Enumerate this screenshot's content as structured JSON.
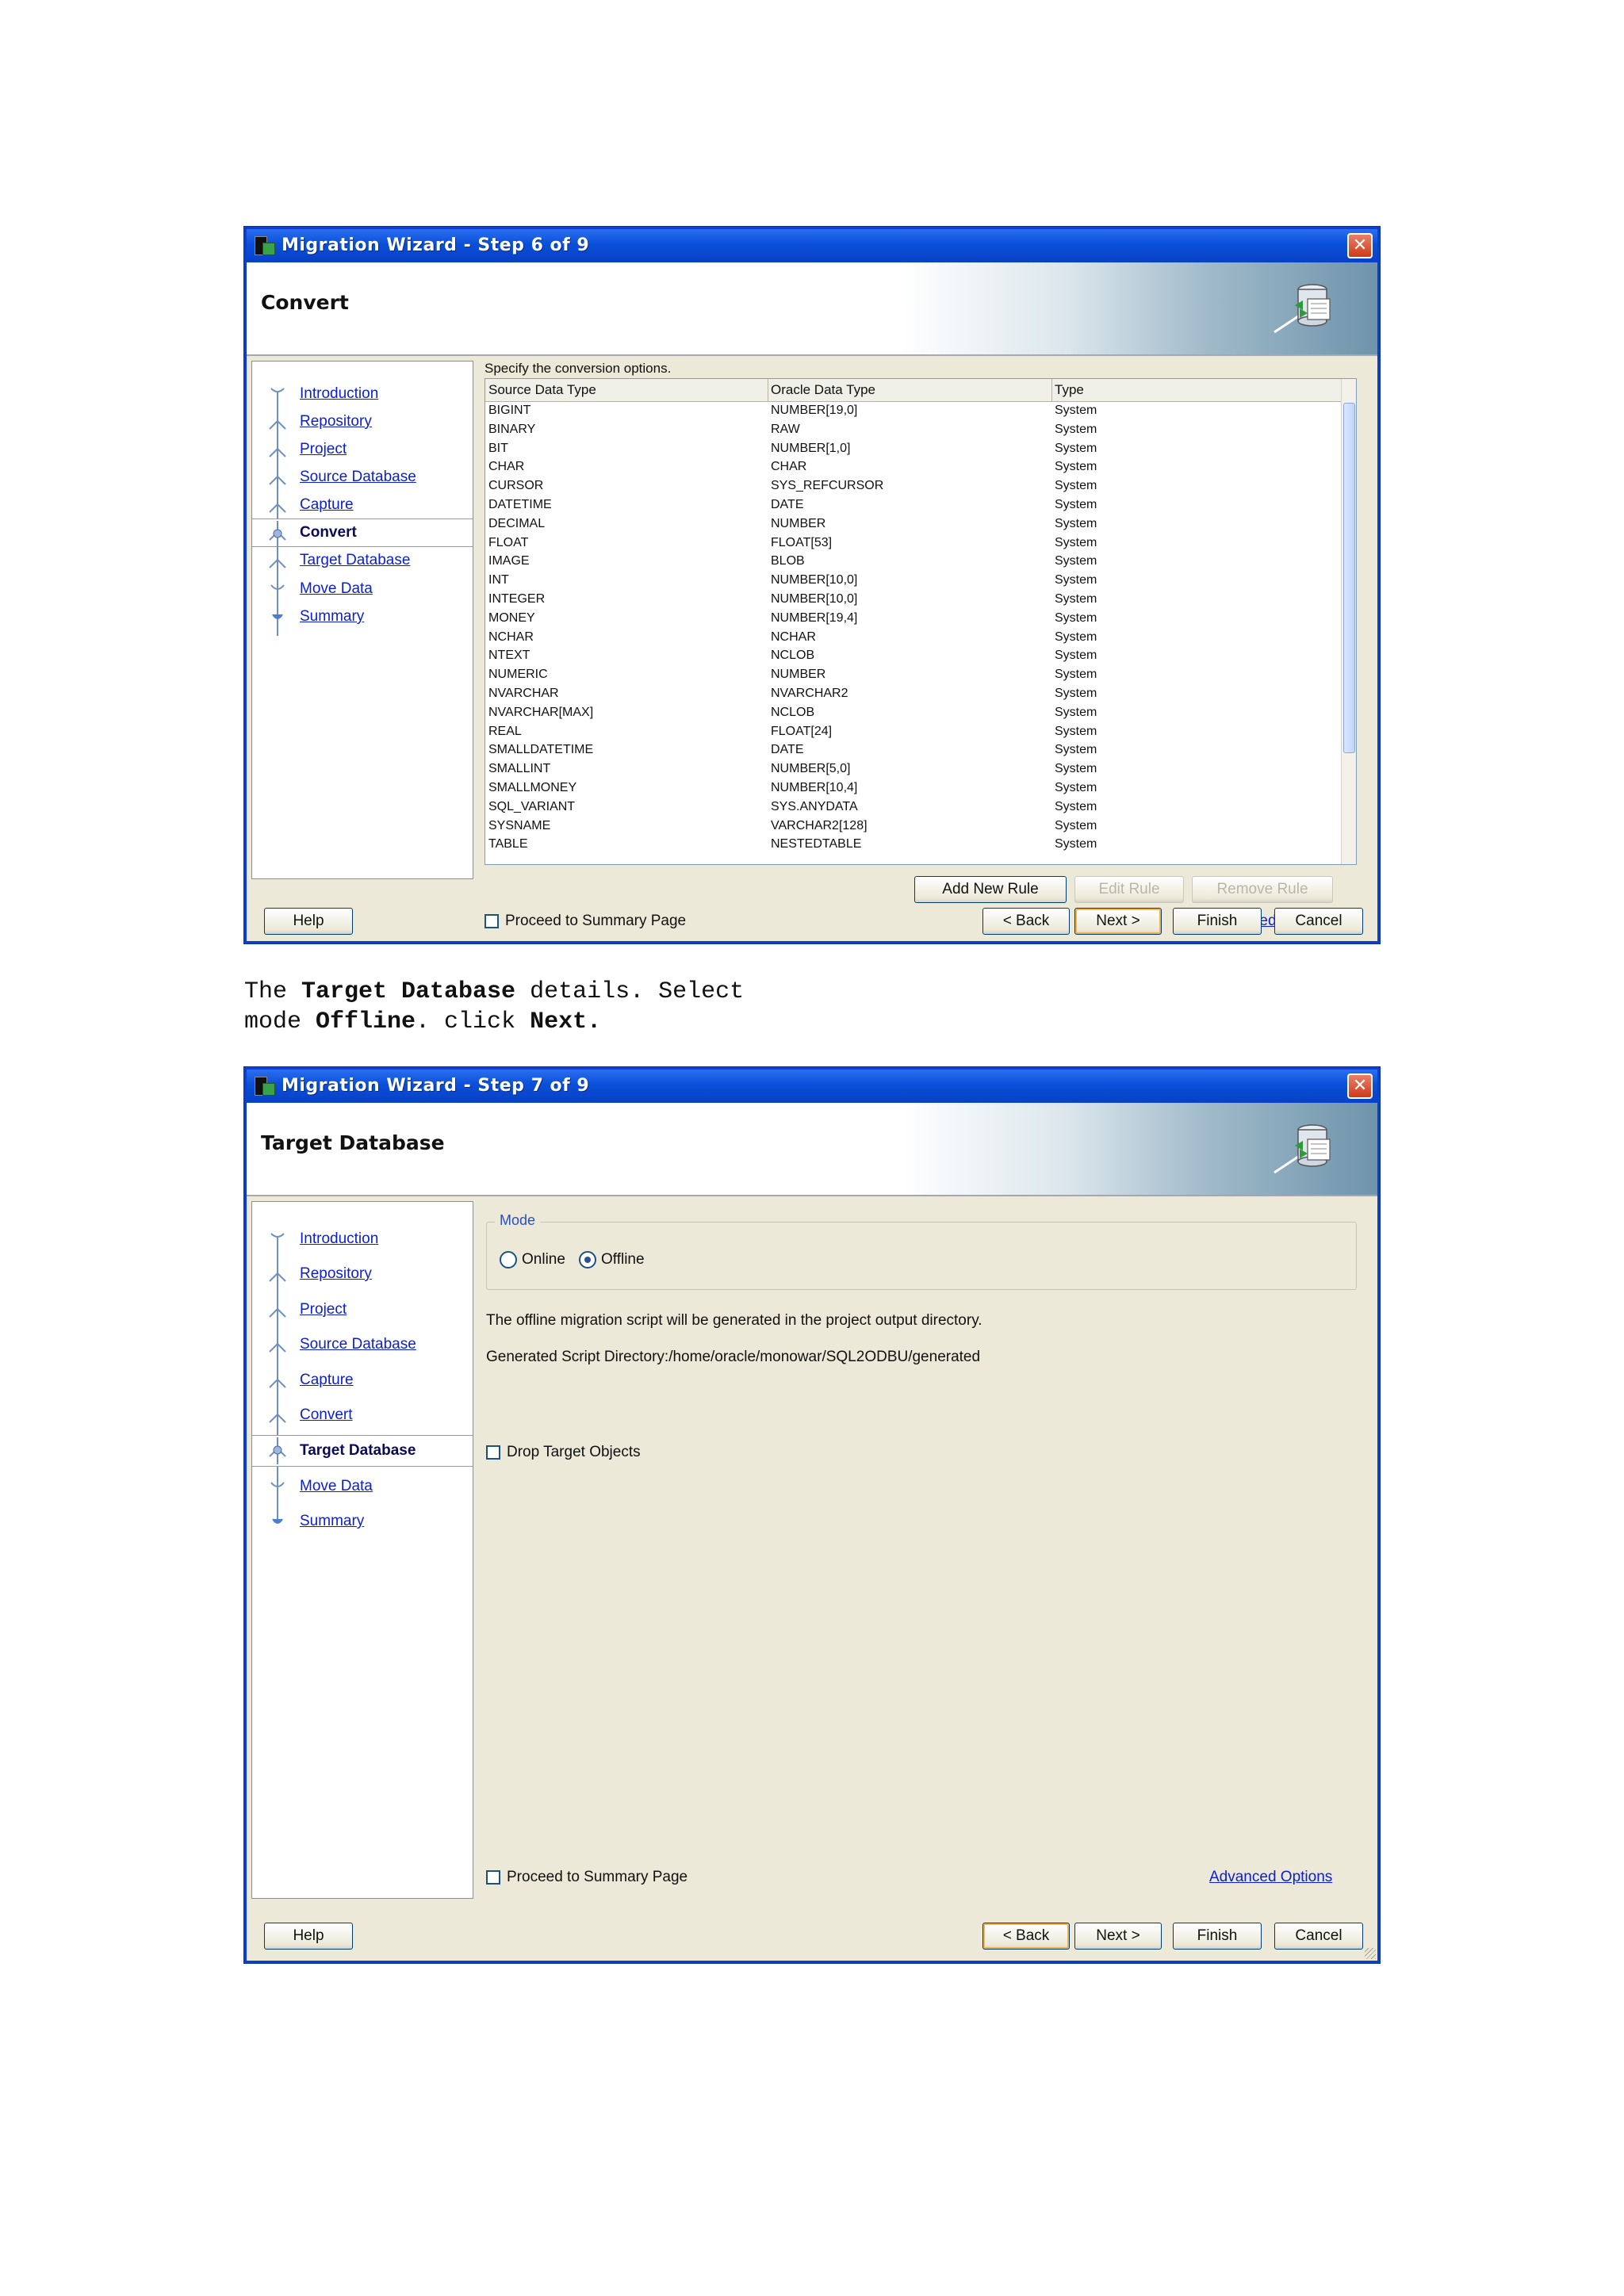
{
  "wizard_step6": {
    "title": "Migration Wizard - Step 6 of 9",
    "page_title": "Convert",
    "nav": [
      "Introduction",
      "Repository",
      "Project",
      "Source Database",
      "Capture",
      "Convert",
      "Target Database",
      "Move Data",
      "Summary"
    ],
    "active_nav": "Convert",
    "instruction": "Specify the conversion options.",
    "table": {
      "columns": [
        "Source Data Type",
        "Oracle Data Type",
        "Type"
      ],
      "rows": [
        [
          "BIGINT",
          "NUMBER[19,0]",
          "System"
        ],
        [
          "BINARY",
          "RAW",
          "System"
        ],
        [
          "BIT",
          "NUMBER[1,0]",
          "System"
        ],
        [
          "CHAR",
          "CHAR",
          "System"
        ],
        [
          "CURSOR",
          "SYS_REFCURSOR",
          "System"
        ],
        [
          "DATETIME",
          "DATE",
          "System"
        ],
        [
          "DECIMAL",
          "NUMBER",
          "System"
        ],
        [
          "FLOAT",
          "FLOAT[53]",
          "System"
        ],
        [
          "IMAGE",
          "BLOB",
          "System"
        ],
        [
          "INT",
          "NUMBER[10,0]",
          "System"
        ],
        [
          "INTEGER",
          "NUMBER[10,0]",
          "System"
        ],
        [
          "MONEY",
          "NUMBER[19,4]",
          "System"
        ],
        [
          "NCHAR",
          "NCHAR",
          "System"
        ],
        [
          "NTEXT",
          "NCLOB",
          "System"
        ],
        [
          "NUMERIC",
          "NUMBER",
          "System"
        ],
        [
          "NVARCHAR",
          "NVARCHAR2",
          "System"
        ],
        [
          "NVARCHAR[MAX]",
          "NCLOB",
          "System"
        ],
        [
          "REAL",
          "FLOAT[24]",
          "System"
        ],
        [
          "SMALLDATETIME",
          "DATE",
          "System"
        ],
        [
          "SMALLINT",
          "NUMBER[5,0]",
          "System"
        ],
        [
          "SMALLMONEY",
          "NUMBER[10,4]",
          "System"
        ],
        [
          "SQL_VARIANT",
          "SYS.ANYDATA",
          "System"
        ],
        [
          "SYSNAME",
          "VARCHAR2[128]",
          "System"
        ],
        [
          "TABLE",
          "NESTEDTABLE",
          "System"
        ]
      ]
    },
    "buttons": {
      "add_rule": "Add New Rule",
      "edit_rule": "Edit Rule",
      "remove_rule": "Remove Rule",
      "help": "Help",
      "back": "< Back",
      "next": "Next >",
      "finish": "Finish",
      "cancel": "Cancel"
    },
    "proceed_label": "Proceed to Summary Page",
    "proceed_checked": false,
    "advanced_options": "Advanced Options"
  },
  "caption": {
    "t1": "The ",
    "b1": "Target Database",
    "t2": " details. Select",
    "t3": "mode ",
    "b2": "Offline",
    "t4": ". click ",
    "b3": "Next."
  },
  "wizard_step7": {
    "title": "Migration Wizard - Step 7 of 9",
    "page_title": "Target Database",
    "nav": [
      "Introduction",
      "Repository",
      "Project",
      "Source Database",
      "Capture",
      "Convert",
      "Target Database",
      "Move Data",
      "Summary"
    ],
    "active_nav": "Target Database",
    "mode_legend": "Mode",
    "mode_online": "Online",
    "mode_offline": "Offline",
    "mode_selected": "Offline",
    "offline_info": "The offline migration script will be generated in the project output directory.",
    "script_dir": "Generated Script Directory:/home/oracle/monowar/SQL2ODBU/generated",
    "drop_target_label": "Drop Target Objects",
    "drop_target_checked": false,
    "proceed_label": "Proceed to Summary Page",
    "proceed_checked": false,
    "advanced_options": "Advanced Options",
    "buttons": {
      "help": "Help",
      "back": "< Back",
      "next": "Next >",
      "finish": "Finish",
      "cancel": "Cancel"
    }
  },
  "colors": {
    "titlebar": "#0a4fd9",
    "link": "#0b1fd0",
    "dialog_bg": "#ece9d8"
  }
}
